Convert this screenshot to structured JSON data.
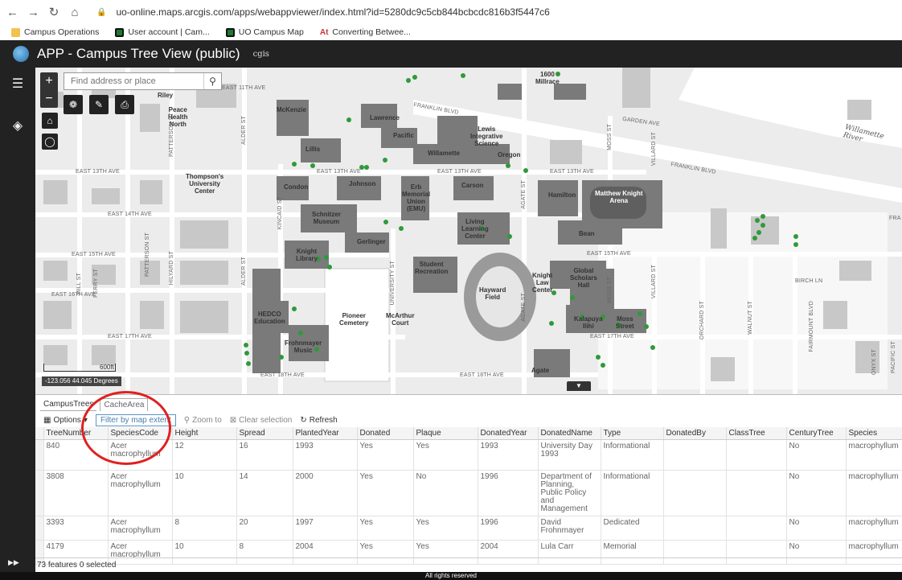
{
  "browser": {
    "url": "uo-online.maps.arcgis.com/apps/webappviewer/index.html?id=5280dc9c5cb844bcbcdc816b3f5447c6",
    "bookmarks": [
      "Campus Operations",
      "User account | Cam...",
      "UO Campus Map",
      "Converting Betwee..."
    ],
    "bookmark_at_glyph": "At"
  },
  "app": {
    "title": "APP - Campus Tree View (public)",
    "subtitle": "cgis"
  },
  "map": {
    "search_placeholder": "Find address or place",
    "scale_label": "600ft",
    "coords": "-123.056 44.045 Degrees",
    "buildings": [
      "Riley",
      "Peace\nHealth\nNorth",
      "McKenzie",
      "Lawrence",
      "Pacific",
      "Lewis\nIntegrative\nScience",
      "Willamette",
      "Oregon",
      "Lillis",
      "Thompson's\nUniversity\nCenter",
      "Condon",
      "Johnson",
      "Erb\nMemorial\nUnion\n(EMU)",
      "Carson",
      "Hamilton",
      "Matthew Knight\nArena",
      "Schnitzer\nMuseum",
      "Living\nLearning\nCenter",
      "Bean",
      "Gerlinger",
      "Knight\nLibrary",
      "Student\nRecreation",
      "Global\nScholars\nHall",
      "Knight\nLaw\nCenter",
      "Hayward\nField",
      "HEDCO\nEducation",
      "Pioneer\nCemetery",
      "McArthur\nCourt",
      "Kalapuya\nIlihi",
      "Moss\nStreet",
      "Frohnmayer\nMusic",
      "Agate",
      "1600\nMillrace"
    ],
    "streets": [
      "EAST 11TH AVE",
      "FRANKLIN BLVD",
      "GARDEN AVE",
      "EAST 13TH AVE",
      "EAST 13TH AVE",
      "EAST 13TH AVE",
      "EAST 13TH AVE",
      "EAST 14TH AVE",
      "EAST 15TH AVE",
      "EAST 15TH AVE",
      "EAST 16TH AVE",
      "EAST 17TH AVE",
      "EAST 17TH AVE",
      "EAST 18TH AVE",
      "EAST 18TH AVE",
      "FRANKLIN BLVD",
      "BIRCH LN",
      "FRA",
      "PATTERSON ST",
      "ALDER ST",
      "KINCAID ST",
      "UNIVERSITY ST",
      "AGATE ST",
      "MOSS ST",
      "VILLARD ST",
      "ORCHARD ST",
      "WALNUT ST",
      "FAIRMOUNT BLVD",
      "HILYARD ST",
      "MILL ST",
      "FERRY ST",
      "PATTERSON ST",
      "ALDER ST",
      "AGATE ST",
      "VILLARD ST",
      "MOSS ST",
      "ONYX ST",
      "PACIFIC ST"
    ],
    "river_label": "Willamette River"
  },
  "table": {
    "tabs": [
      "CampusTrees",
      "CacheArea"
    ],
    "toolbar": {
      "options": "Options",
      "filter": "Filter by map extent",
      "zoom": "Zoom to",
      "clear": "Clear selection",
      "refresh": "Refresh"
    },
    "columns": [
      "TreeNumber",
      "SpeciesCode",
      "Height",
      "Spread",
      "PlantedYear",
      "Donated",
      "Plaque",
      "DonatedYear",
      "DonatedName",
      "Type",
      "DonatedBy",
      "ClassTree",
      "CenturyTree",
      "Species"
    ],
    "rows": [
      [
        "840",
        "Acer macrophyllum",
        "12",
        "16",
        "1993",
        "Yes",
        "Yes",
        "1993",
        "University Day 1993",
        "Informational",
        "",
        "",
        "No",
        "macrophyllum"
      ],
      [
        "3808",
        "Acer macrophyllum",
        "10",
        "14",
        "2000",
        "Yes",
        "No",
        "1996",
        "Department of Planning, Public Policy and Management",
        "Informational",
        "",
        "",
        "No",
        "macrophyllum"
      ],
      [
        "3393",
        "Acer macrophyllum",
        "8",
        "20",
        "1997",
        "Yes",
        "Yes",
        "1996",
        "David Frohnmayer",
        "Dedicated",
        "",
        "",
        "No",
        "macrophyllum"
      ],
      [
        "4179",
        "Acer macrophyllum",
        "10",
        "8",
        "2004",
        "Yes",
        "Yes",
        "2004",
        "Lula Carr",
        "Memorial",
        "",
        "",
        "No",
        "macrophyllum"
      ]
    ],
    "footer": "73 features 0 selected"
  },
  "bottom_bar": "All rights reserved",
  "colors": {
    "header": "#222222",
    "tree": "#2e9a3a",
    "highlight": "#e02020",
    "filter_border": "#5a95c8"
  }
}
